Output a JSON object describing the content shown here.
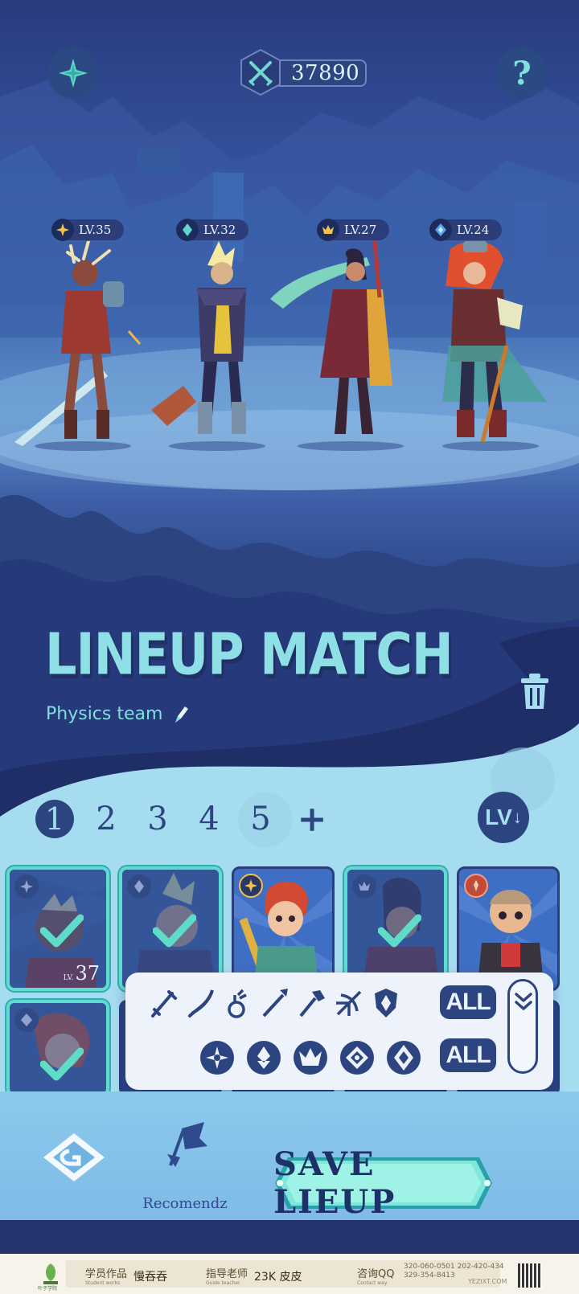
{
  "header": {
    "power_value": "37890",
    "help_label": "?"
  },
  "heroes": [
    {
      "level": "LV.35",
      "element": "star"
    },
    {
      "level": "LV.32",
      "element": "drop"
    },
    {
      "level": "LV.27",
      "element": "crown"
    },
    {
      "level": "LV.24",
      "element": "gem"
    }
  ],
  "title": "LINEUP MATCH",
  "team_name": "Physics team",
  "pages": [
    "1",
    "2",
    "3",
    "4",
    "5"
  ],
  "active_page": "1",
  "add_page_label": "+",
  "sort_button": {
    "label": "LV",
    "arrow": "↓"
  },
  "cards": [
    {
      "selected": true,
      "level_prefix": "LV.",
      "level": "37"
    },
    {
      "selected": true,
      "level_prefix": "",
      "level": ""
    },
    {
      "selected": false,
      "level_prefix": "",
      "level": ""
    },
    {
      "selected": true,
      "level_prefix": "",
      "level": ""
    },
    {
      "selected": false,
      "level_prefix": "",
      "level": ""
    },
    {
      "selected": true,
      "level_prefix": "",
      "level": ""
    }
  ],
  "filter": {
    "weapon_types": [
      "sword-icon",
      "scimitar-icon",
      "potion-icon",
      "spear-icon",
      "hammer-icon",
      "crossbow-icon",
      "shield-icon"
    ],
    "elements": [
      "star-element-icon",
      "drop-element-icon",
      "crown-element-icon",
      "gem-element-icon",
      "diamond-element-icon"
    ],
    "all_label_1": "ALL",
    "all_label_2": "ALL"
  },
  "bottom": {
    "recommend_label": "Recomendz",
    "save_label": "SAVE LIEUP"
  },
  "footer": {
    "student_cn": "学员作品",
    "student_en": "Student works",
    "student_name": "慢吞吞",
    "teacher_cn": "指导老师",
    "teacher_en": "Guide teacher",
    "teacher_name": "23K  皮皮",
    "contact_cn": "咨询QQ",
    "contact_en": "Contact way",
    "qq_numbers": "320-060-0501  202-420-434",
    "qq_numbers_2": "329-354-8413",
    "site": "YEZIXT.COM",
    "brand": "叶子学院"
  },
  "colors": {
    "accent": "#7fe0dc",
    "navy": "#2c4480",
    "panel": "#a6dcef"
  }
}
